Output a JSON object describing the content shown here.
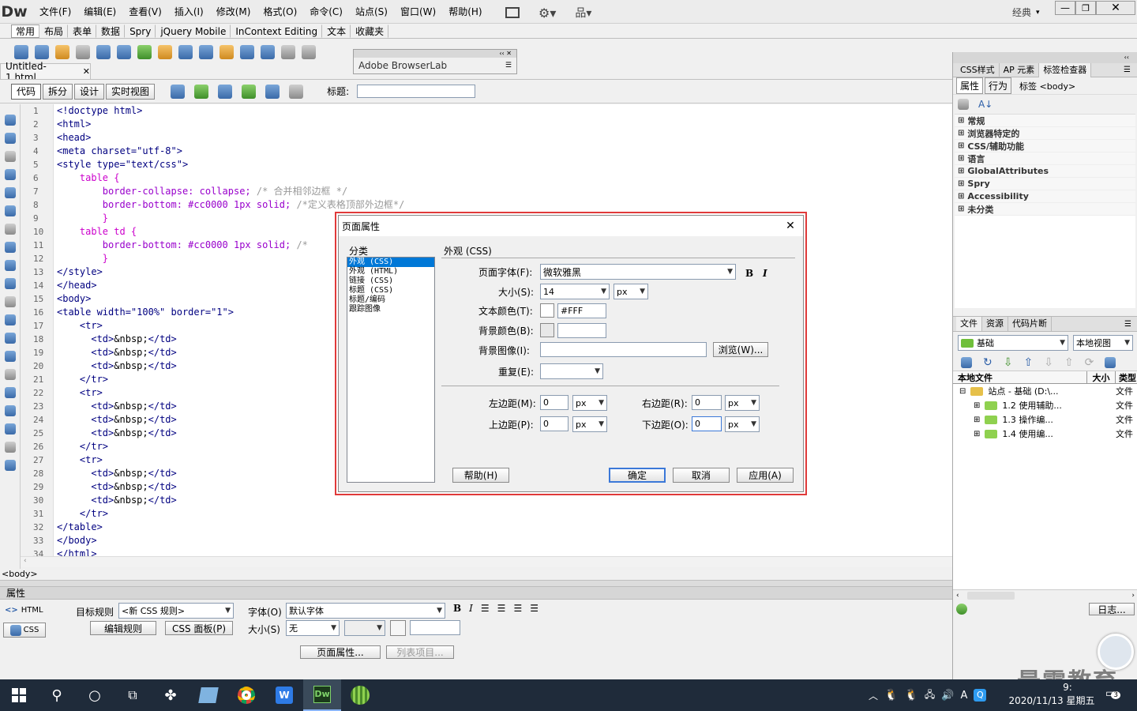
{
  "app": {
    "logo": "Dw",
    "workspace": "经典"
  },
  "menu": [
    "文件(F)",
    "编辑(E)",
    "查看(V)",
    "插入(I)",
    "修改(M)",
    "格式(O)",
    "命令(C)",
    "站点(S)",
    "窗口(W)",
    "帮助(H)"
  ],
  "insert_tabs": [
    "常用",
    "布局",
    "表单",
    "数据",
    "Spry",
    "jQuery Mobile",
    "InContext Editing",
    "文本",
    "收藏夹"
  ],
  "doc_tab": "Untitled-1.html",
  "view_buttons": [
    "代码",
    "拆分",
    "设计",
    "实时视图"
  ],
  "title_label": "标题:",
  "browserlab": {
    "title": "Adobe BrowserLab"
  },
  "code_lines": [
    "<!doctype html>",
    "<html>",
    "<head>",
    "<meta charset=\"utf-8\">",
    "<style type=\"text/css\">",
    "    table {",
    "        border-collapse: collapse; /* 合并相邻边框 */",
    "        border-bottom: #cc0000 1px solid; /*定义表格顶部外边框*/",
    "        }",
    "    table td {",
    "        border-bottom: #cc0000 1px solid; /*",
    "        }",
    "</style>",
    "</head>",
    "<body>",
    "<table width=\"100%\" border=\"1\">",
    "    <tr>",
    "      <td>&nbsp;</td>",
    "      <td>&nbsp;</td>",
    "      <td>&nbsp;</td>",
    "    </tr>",
    "    <tr>",
    "      <td>&nbsp;</td>",
    "      <td>&nbsp;</td>",
    "      <td>&nbsp;</td>",
    "    </tr>",
    "    <tr>",
    "      <td>&nbsp;</td>",
    "      <td>&nbsp;</td>",
    "      <td>&nbsp;</td>",
    "    </tr>",
    "</table>",
    "</body>",
    "</html>"
  ],
  "tag_selector": "<body>",
  "dialog": {
    "title": "页面属性",
    "category_label": "分类",
    "categories": [
      "外观 (CSS)",
      "外观 (HTML)",
      "链接 (CSS)",
      "标题 (CSS)",
      "标题/编码",
      "跟踪图像"
    ],
    "section": "外观 (CSS)",
    "font_label": "页面字体(F):",
    "font_value": "微软雅黑",
    "bold": "B",
    "italic": "I",
    "size_label": "大小(S):",
    "size_value": "14",
    "size_unit": "px",
    "text_color_label": "文本颜色(T):",
    "text_color_value": "#FFF",
    "bg_color_label": "背景颜色(B):",
    "bg_image_label": "背景图像(I):",
    "browse": "浏览(W)...",
    "repeat_label": "重复(E):",
    "left_margin_label": "左边距(M):",
    "right_margin_label": "右边距(R):",
    "top_margin_label": "上边距(P):",
    "bottom_margin_label": "下边距(O):",
    "margin_value": "0",
    "unit": "px",
    "help": "帮助(H)",
    "ok": "确定",
    "cancel": "取消",
    "apply": "应用(A)"
  },
  "right_panel": {
    "tabs": [
      "CSS样式",
      "AP 元素",
      "标签检查器"
    ],
    "subtabs": [
      "属性",
      "行为"
    ],
    "tag_label": "标签 <body>",
    "groups": [
      "常规",
      "浏览器特定的",
      "CSS/辅助功能",
      "语言",
      "GlobalAttributes",
      "Spry",
      "Accessibility",
      "未分类"
    ]
  },
  "files_panel": {
    "tabs": [
      "文件",
      "资源",
      "代码片断"
    ],
    "site": "基础",
    "view": "本地视图",
    "col_local": "本地文件",
    "col_size": "大小",
    "col_type": "类型",
    "root": "站点 - 基础 (D:\\...",
    "root_type": "文件",
    "items": [
      {
        "name": "1.2 使用辅助...",
        "type": "文件"
      },
      {
        "name": "1.3 操作编...",
        "type": "文件"
      },
      {
        "name": "1.4 使用编...",
        "type": "文件"
      }
    ],
    "log": "日志..."
  },
  "props": {
    "title": "属性",
    "html": "HTML",
    "css": "CSS",
    "target_label": "目标规则",
    "target_value": "<新 CSS 规则>",
    "edit_rule": "编辑规则",
    "css_panel": "CSS 面板(P)",
    "font_label": "字体(O)",
    "font_value": "默认字体",
    "size_label": "大小(S)",
    "size_value": "无",
    "page_props": "页面属性...",
    "list_item": "列表项目..."
  },
  "taskbar": {
    "ime": "A",
    "time": "9:",
    "date": "2020/11/13 星期五",
    "badge": "3"
  },
  "watermark": "最需教育"
}
